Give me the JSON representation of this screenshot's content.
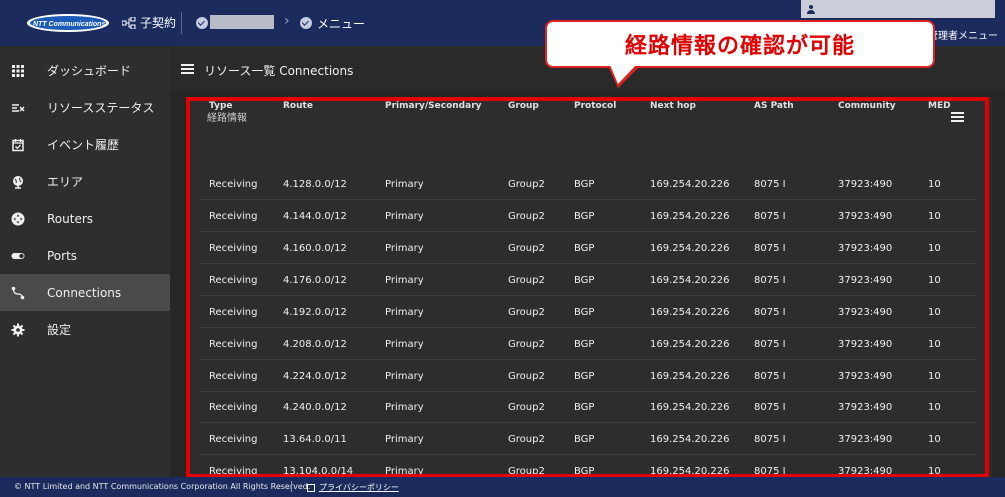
{
  "header": {
    "logo_text": "NTT Communications",
    "contract_label": "子契約",
    "menu_label": "メニュー",
    "admin_menu_label": "管理者メニュー",
    "crumb_arrow": "›"
  },
  "sidebar": {
    "items": [
      {
        "label": "ダッシュボード",
        "icon": "dashboard-grid-icon",
        "active": false
      },
      {
        "label": "リソースステータス",
        "icon": "resource-status-icon",
        "active": false
      },
      {
        "label": "イベント履歴",
        "icon": "event-history-icon",
        "active": false
      },
      {
        "label": "エリア",
        "icon": "globe-icon",
        "active": false
      },
      {
        "label": "Routers",
        "icon": "router-icon",
        "active": false
      },
      {
        "label": "Ports",
        "icon": "ports-icon",
        "active": false
      },
      {
        "label": "Connections",
        "icon": "connections-icon",
        "active": true
      },
      {
        "label": "設定",
        "icon": "gear-icon",
        "active": false
      }
    ]
  },
  "page": {
    "title": "リソース一覧 Connections"
  },
  "card": {
    "title": "経路情報"
  },
  "table": {
    "columns": [
      "Type",
      "Route",
      "Primary/Secondary",
      "Group",
      "Protocol",
      "Next hop",
      "AS Path",
      "Community",
      "MED"
    ],
    "rows": [
      [
        "Receiving",
        "4.128.0.0/12",
        "Primary",
        "Group2",
        "BGP",
        "169.254.20.226",
        "8075 I",
        "37923:490",
        "10"
      ],
      [
        "Receiving",
        "4.144.0.0/12",
        "Primary",
        "Group2",
        "BGP",
        "169.254.20.226",
        "8075 I",
        "37923:490",
        "10"
      ],
      [
        "Receiving",
        "4.160.0.0/12",
        "Primary",
        "Group2",
        "BGP",
        "169.254.20.226",
        "8075 I",
        "37923:490",
        "10"
      ],
      [
        "Receiving",
        "4.176.0.0/12",
        "Primary",
        "Group2",
        "BGP",
        "169.254.20.226",
        "8075 I",
        "37923:490",
        "10"
      ],
      [
        "Receiving",
        "4.192.0.0/12",
        "Primary",
        "Group2",
        "BGP",
        "169.254.20.226",
        "8075 I",
        "37923:490",
        "10"
      ],
      [
        "Receiving",
        "4.208.0.0/12",
        "Primary",
        "Group2",
        "BGP",
        "169.254.20.226",
        "8075 I",
        "37923:490",
        "10"
      ],
      [
        "Receiving",
        "4.224.0.0/12",
        "Primary",
        "Group2",
        "BGP",
        "169.254.20.226",
        "8075 I",
        "37923:490",
        "10"
      ],
      [
        "Receiving",
        "4.240.0.0/12",
        "Primary",
        "Group2",
        "BGP",
        "169.254.20.226",
        "8075 I",
        "37923:490",
        "10"
      ],
      [
        "Receiving",
        "13.64.0.0/11",
        "Primary",
        "Group2",
        "BGP",
        "169.254.20.226",
        "8075 I",
        "37923:490",
        "10"
      ],
      [
        "Receiving",
        "13.104.0.0/14",
        "Primary",
        "Group2",
        "BGP",
        "169.254.20.226",
        "8075 I",
        "37923:490",
        "10"
      ]
    ]
  },
  "annotation": {
    "callout_text": "経路情報の確認が可能",
    "color": "#e00000"
  },
  "footer": {
    "copyright": "© NTT Limited and NTT Communications Corporation All Rights Reserved.",
    "privacy_label": "プライバシーポリシー"
  },
  "colors": {
    "header_bg": "#1c2b5e",
    "sidebar_bg": "#2e2e2e",
    "main_bg": "#262626",
    "highlight": "#e00000"
  }
}
